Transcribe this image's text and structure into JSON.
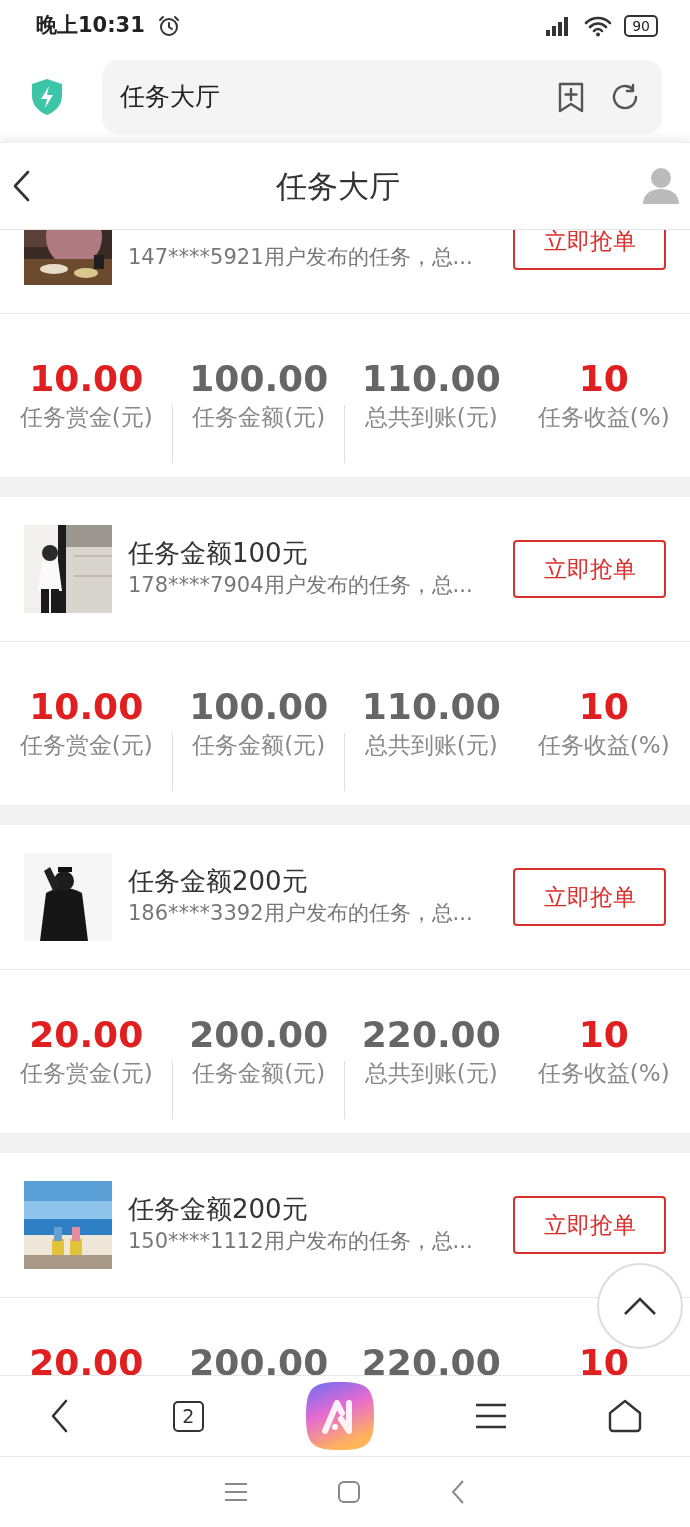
{
  "status_bar": {
    "time": "晚上10:31",
    "battery": "90"
  },
  "browser": {
    "address": "任务大厅",
    "tab_count": "2"
  },
  "header": {
    "title": "任务大厅"
  },
  "tasks": [
    {
      "subtitle": "147****5921用户发布的任务，总...",
      "action": "立即抢单",
      "stats": [
        {
          "value": "10.00",
          "label": "任务赏金(元)",
          "highlight": true
        },
        {
          "value": "100.00",
          "label": "任务金额(元)",
          "highlight": false
        },
        {
          "value": "110.00",
          "label": "总共到账(元)",
          "highlight": false
        },
        {
          "value": "10",
          "label": "任务收益(%)",
          "highlight": true
        }
      ]
    },
    {
      "title": "任务金额100元",
      "subtitle": "178****7904用户发布的任务，总...",
      "action": "立即抢单",
      "stats": [
        {
          "value": "10.00",
          "label": "任务赏金(元)",
          "highlight": true
        },
        {
          "value": "100.00",
          "label": "任务金额(元)",
          "highlight": false
        },
        {
          "value": "110.00",
          "label": "总共到账(元)",
          "highlight": false
        },
        {
          "value": "10",
          "label": "任务收益(%)",
          "highlight": true
        }
      ]
    },
    {
      "title": "任务金额200元",
      "subtitle": "186****3392用户发布的任务，总...",
      "action": "立即抢单",
      "stats": [
        {
          "value": "20.00",
          "label": "任务赏金(元)",
          "highlight": true
        },
        {
          "value": "200.00",
          "label": "任务金额(元)",
          "highlight": false
        },
        {
          "value": "220.00",
          "label": "总共到账(元)",
          "highlight": false
        },
        {
          "value": "10",
          "label": "任务收益(%)",
          "highlight": true
        }
      ]
    },
    {
      "title": "任务金额200元",
      "subtitle": "150****1112用户发布的任务，总...",
      "action": "立即抢单",
      "stats": [
        {
          "value": "20.00",
          "highlight": true
        },
        {
          "value": "200.00",
          "highlight": false
        },
        {
          "value": "220.00",
          "highlight": false
        },
        {
          "value": "10",
          "highlight": true
        }
      ]
    }
  ]
}
